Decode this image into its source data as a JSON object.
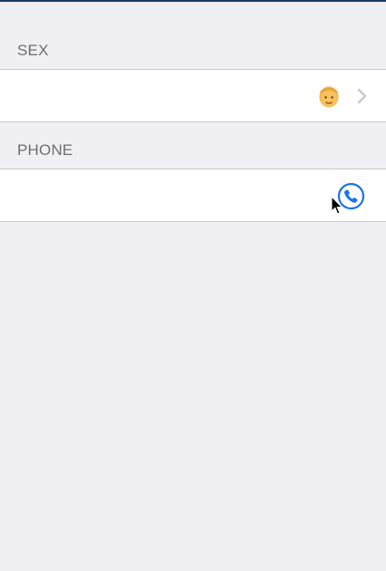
{
  "sections": {
    "sex": {
      "header": "SEX",
      "value_icon": "male-face-emoji-icon",
      "accessory_icon": "chevron-right-icon"
    },
    "phone": {
      "header": "PHONE",
      "action_icon": "phone-call-icon"
    }
  },
  "colors": {
    "background": "#efeff4",
    "cell_background": "#ffffff",
    "separator": "#c8c7cc",
    "header_text": "#6d6d72",
    "accent": "#1a73e8",
    "top_bar": "#1f3b63"
  }
}
